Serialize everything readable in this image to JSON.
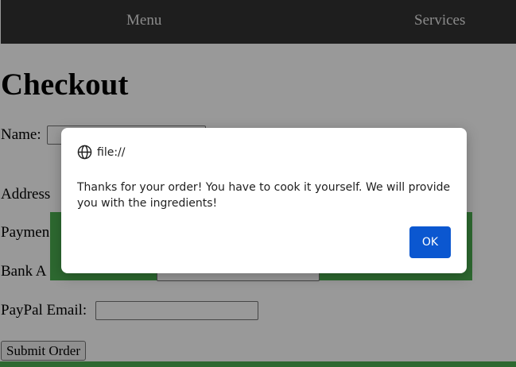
{
  "nav": {
    "menu_label": "Menu",
    "services_label": "Services"
  },
  "checkout": {
    "title": "Checkout",
    "name_label": "Name:",
    "address_label": "Address",
    "payment_label": "Paymen",
    "bank_label": "Bank A",
    "paypal_label": "PayPal Email:",
    "submit_label": "Submit Order"
  },
  "alert": {
    "origin": "file://",
    "message": "Thanks for your order! You have to cook it yourself. We will provide you with the ingredients!",
    "ok_label": "OK"
  },
  "colors": {
    "nav_bg": "#333333",
    "accent_green": "#4caf50",
    "ok_button": "#0b57d0"
  },
  "icons": {
    "dialog_origin_icon": "globe-icon"
  }
}
